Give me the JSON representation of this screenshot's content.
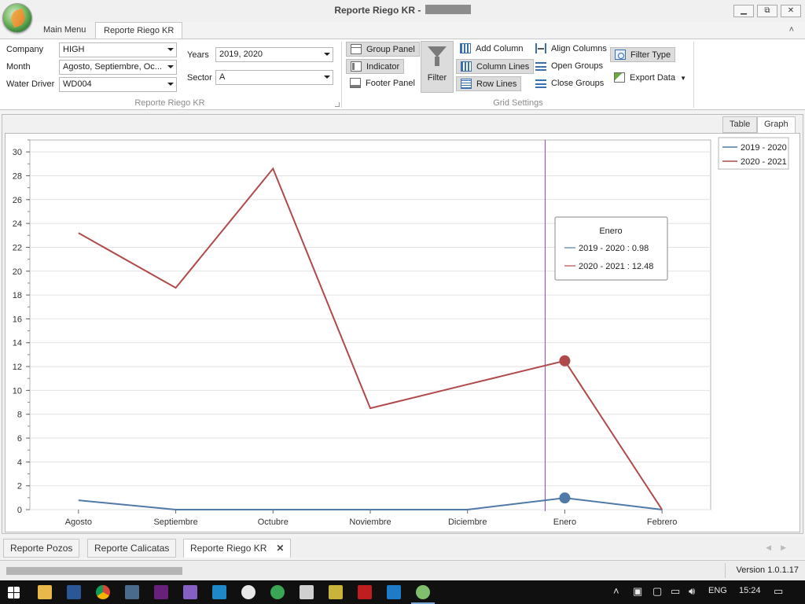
{
  "window": {
    "title": "Reporte Riego KR -",
    "minimize_icon": "minimize-icon",
    "maximize_icon": "restore-icon",
    "close_icon": "close-icon"
  },
  "ribbon_tabs": [
    "Main Menu",
    "Reporte Riego KR"
  ],
  "filters": {
    "company_label": "Company",
    "company_value": "HIGH",
    "month_label": "Month",
    "month_value": "Agosto, Septiembre, Oc...",
    "water_driver_label": "Water Driver",
    "water_driver_value": "WD004",
    "years_label": "Years",
    "years_value": "2019, 2020",
    "sector_label": "Sector",
    "sector_value": "A",
    "group_caption": "Reporte Riego KR"
  },
  "grid_settings": {
    "group_panel": "Group Panel",
    "indicator": "Indicator",
    "footer_panel": "Footer Panel",
    "filter": "Filter",
    "add_column": "Add Column",
    "column_lines": "Column Lines",
    "row_lines": "Row Lines",
    "align_columns": "Align Columns",
    "open_groups": "Open Groups",
    "close_groups": "Close Groups",
    "filter_type": "Filter Type",
    "export_data": "Export Data",
    "group_caption": "Grid Settings"
  },
  "view_tabs": [
    "Table",
    "Graph"
  ],
  "chart_data": {
    "type": "line",
    "categories": [
      "Agosto",
      "Septiembre",
      "Octubre",
      "Noviembre",
      "Diciembre",
      "Enero",
      "Febrero"
    ],
    "yticks": [
      0,
      2,
      4,
      6,
      8,
      10,
      12,
      14,
      16,
      18,
      20,
      22,
      24,
      26,
      28,
      30
    ],
    "ylim": [
      0,
      31
    ],
    "grid": true,
    "legend_position": "top-right",
    "series": [
      {
        "name": "2019 - 2020",
        "color": "#4f7aa8",
        "values": [
          0.78,
          0.0,
          0.0,
          0.0,
          0.0,
          0.98,
          0.0
        ]
      },
      {
        "name": "2020 - 2021",
        "color": "#b04a4a",
        "values": [
          23.2,
          18.6,
          28.6,
          8.5,
          10.5,
          12.48,
          0.0
        ]
      }
    ],
    "crosshair_category": "Enero",
    "tooltip": {
      "title": "Enero",
      "rows": [
        "2019 - 2020 : 0.98",
        "2020 - 2021 : 12.48"
      ]
    }
  },
  "document_tabs": [
    "Reporte Pozos",
    "Reporte Calicatas",
    "Reporte Riego KR"
  ],
  "status": {
    "version": "Version 1.0.1.17"
  },
  "taskbar": {
    "language": "ENG",
    "time": "15:24"
  }
}
